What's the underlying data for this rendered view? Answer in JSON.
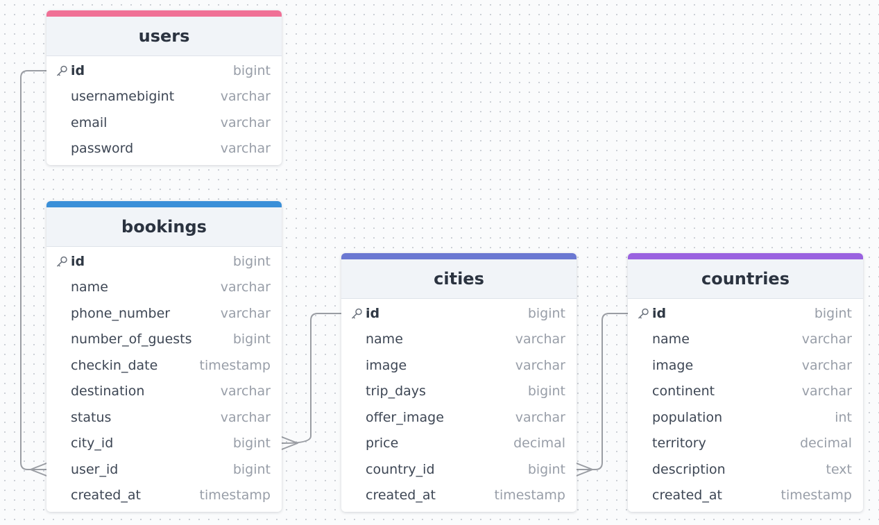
{
  "colors": {
    "users": "#f07096",
    "bookings": "#3a8fd8",
    "cities": "#6b78d2",
    "countries": "#9a62e0",
    "connector": "#9a9da3"
  },
  "tables": [
    {
      "name": "users",
      "columns": [
        {
          "name": "id",
          "type": "bigint",
          "pk": true
        },
        {
          "name": "usernamebigint",
          "type": "varchar"
        },
        {
          "name": "email",
          "type": "varchar"
        },
        {
          "name": "password",
          "type": "varchar"
        }
      ]
    },
    {
      "name": "bookings",
      "columns": [
        {
          "name": "id",
          "type": "bigint",
          "pk": true
        },
        {
          "name": "name",
          "type": "varchar"
        },
        {
          "name": "phone_number",
          "type": "varchar"
        },
        {
          "name": "number_of_guests",
          "type": "bigint"
        },
        {
          "name": "checkin_date",
          "type": "timestamp"
        },
        {
          "name": "destination",
          "type": "varchar"
        },
        {
          "name": "status",
          "type": "varchar"
        },
        {
          "name": "city_id",
          "type": "bigint"
        },
        {
          "name": "user_id",
          "type": "bigint"
        },
        {
          "name": "created_at",
          "type": "timestamp"
        }
      ]
    },
    {
      "name": "cities",
      "columns": [
        {
          "name": "id",
          "type": "bigint",
          "pk": true
        },
        {
          "name": "name",
          "type": "varchar"
        },
        {
          "name": "image",
          "type": "varchar"
        },
        {
          "name": "trip_days",
          "type": "bigint"
        },
        {
          "name": "offer_image",
          "type": "varchar"
        },
        {
          "name": "price",
          "type": "decimal"
        },
        {
          "name": "country_id",
          "type": "bigint"
        },
        {
          "name": "created_at",
          "type": "timestamp"
        }
      ]
    },
    {
      "name": "countries",
      "columns": [
        {
          "name": "id",
          "type": "bigint",
          "pk": true
        },
        {
          "name": "name",
          "type": "varchar"
        },
        {
          "name": "image",
          "type": "varchar"
        },
        {
          "name": "continent",
          "type": "varchar"
        },
        {
          "name": "population",
          "type": "int"
        },
        {
          "name": "territory",
          "type": "decimal"
        },
        {
          "name": "description",
          "type": "text"
        },
        {
          "name": "created_at",
          "type": "timestamp"
        }
      ]
    }
  ],
  "relationships": [
    {
      "from": "bookings.user_id",
      "to": "users.id",
      "cardinality": "many-to-one"
    },
    {
      "from": "bookings.city_id",
      "to": "cities.id",
      "cardinality": "many-to-one"
    },
    {
      "from": "cities.country_id",
      "to": "countries.id",
      "cardinality": "many-to-one"
    }
  ]
}
